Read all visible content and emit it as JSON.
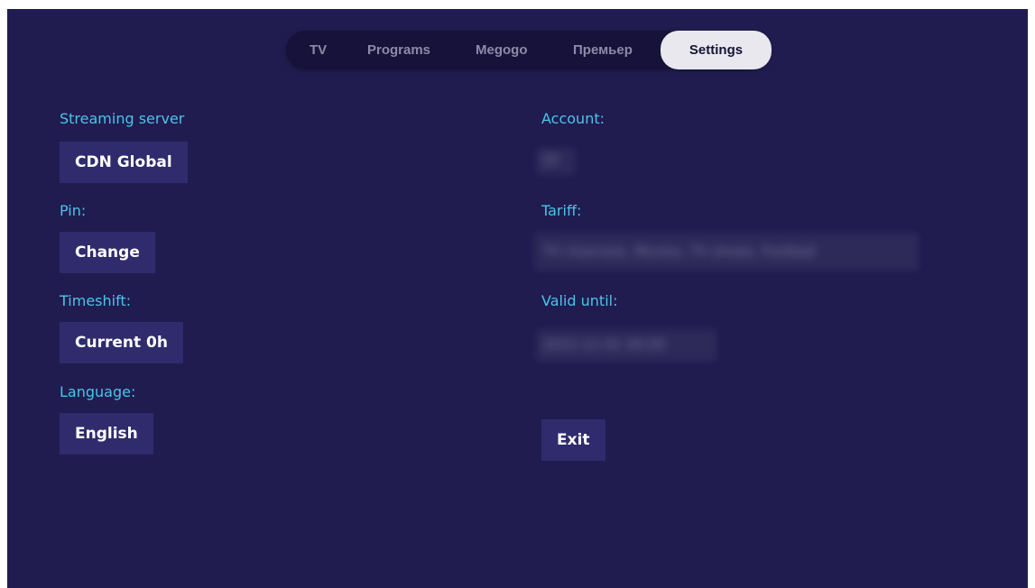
{
  "tabs": {
    "tv": "TV",
    "programs": "Programs",
    "megogo": "Megogo",
    "premier": "Премьер",
    "settings": "Settings"
  },
  "left": {
    "streaming_server_label": "Streaming server",
    "streaming_server_value": "CDN Global",
    "pin_label": "Pin:",
    "pin_button": "Change",
    "timeshift_label": "Timeshift:",
    "timeshift_value": "Current 0h",
    "language_label": "Language:",
    "language_value": "English"
  },
  "right": {
    "account_label": "Account:",
    "account_value": "10",
    "tariff_label": "Tariff:",
    "tariff_value": "TV channels, Movies, TV shows, Football",
    "valid_until_label": "Valid until:",
    "valid_until_value": "2021-11-01 00:00",
    "exit_button": "Exit"
  },
  "colors": {
    "background": "#201c4f",
    "label_accent": "#4cc3ea",
    "button_bg": "#2f2b6c",
    "tab_active_bg": "#e9e8ee"
  }
}
